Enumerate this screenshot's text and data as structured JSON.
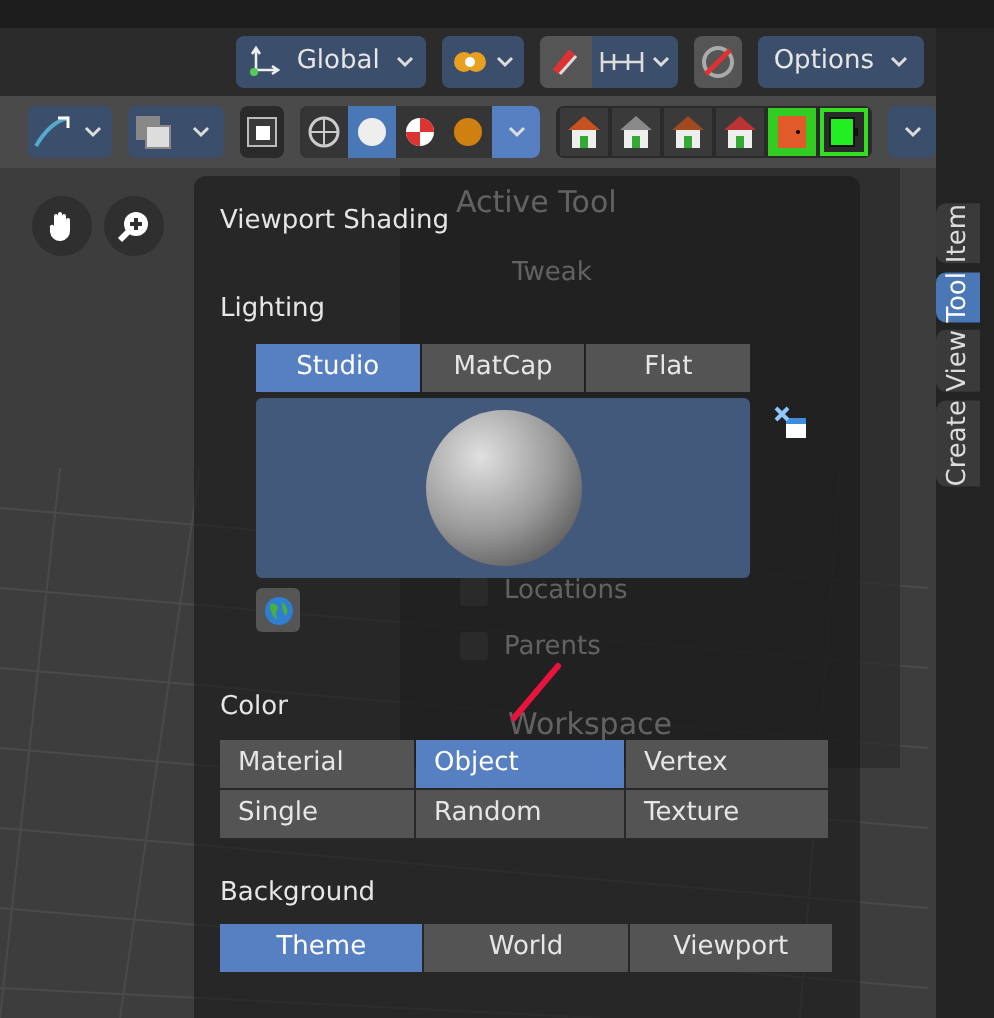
{
  "header": {
    "orientation": "Global",
    "options": "Options"
  },
  "shading_modes": [
    {
      "selected": false
    },
    {
      "selected": true
    },
    {
      "selected": false
    },
    {
      "selected": false
    }
  ],
  "sidebar_tabs": [
    {
      "label": "Item",
      "selected": false
    },
    {
      "label": "Tool",
      "selected": true
    },
    {
      "label": "View",
      "selected": false
    },
    {
      "label": "Create",
      "selected": false
    }
  ],
  "sidebar_panel": {
    "title": "Active Tool",
    "tool": "Tweak",
    "checkboxes": [
      {
        "label": "Locations",
        "checked": false
      },
      {
        "label": "Parents",
        "checked": false
      }
    ],
    "section": "Workspace"
  },
  "popup": {
    "title": "Viewport Shading",
    "lighting": {
      "label": "Lighting",
      "options": [
        {
          "label": "Studio",
          "selected": true
        },
        {
          "label": "MatCap",
          "selected": false
        },
        {
          "label": "Flat",
          "selected": false
        }
      ]
    },
    "color": {
      "label": "Color",
      "options": [
        {
          "label": "Material",
          "selected": false
        },
        {
          "label": "Object",
          "selected": true
        },
        {
          "label": "Vertex",
          "selected": false
        },
        {
          "label": "Single",
          "selected": false
        },
        {
          "label": "Random",
          "selected": false
        },
        {
          "label": "Texture",
          "selected": false
        }
      ]
    },
    "background": {
      "label": "Background",
      "options": [
        {
          "label": "Theme",
          "selected": true
        },
        {
          "label": "World",
          "selected": false
        },
        {
          "label": "Viewport",
          "selected": false
        }
      ]
    }
  }
}
